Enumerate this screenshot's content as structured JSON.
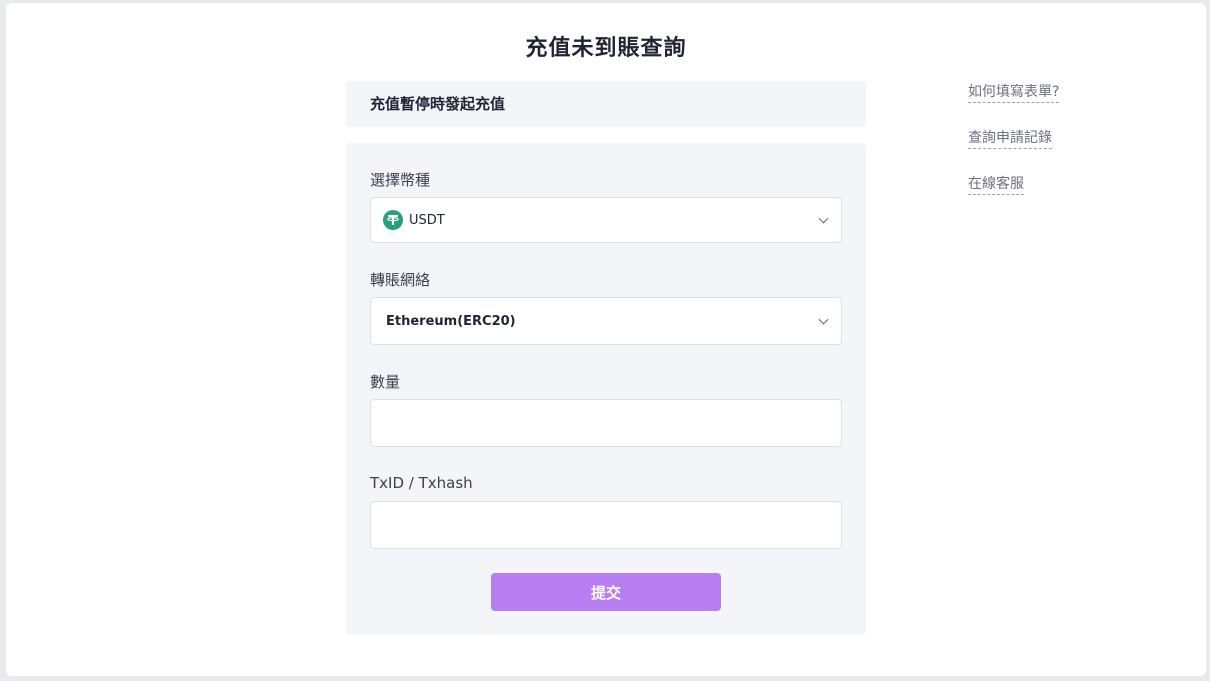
{
  "page": {
    "title": "充值未到賬查詢"
  },
  "notice": {
    "text": "充值暫停時發起充值"
  },
  "form": {
    "coin": {
      "label": "選擇幣種",
      "value": "USDT",
      "icon": "tether-icon",
      "icon_color": "#26a17b"
    },
    "network": {
      "label": "轉賬網絡",
      "value": "Ethereum(ERC20)"
    },
    "amount": {
      "label": "數量",
      "value": "",
      "placeholder": ""
    },
    "txid": {
      "label": "TxID / Txhash",
      "value": "",
      "placeholder": ""
    },
    "submit_label": "提交",
    "submit_color": "#b67ef0"
  },
  "side_links": [
    {
      "label": "如何填寫表單?"
    },
    {
      "label": "查詢申請記錄"
    },
    {
      "label": "在線客服"
    }
  ]
}
